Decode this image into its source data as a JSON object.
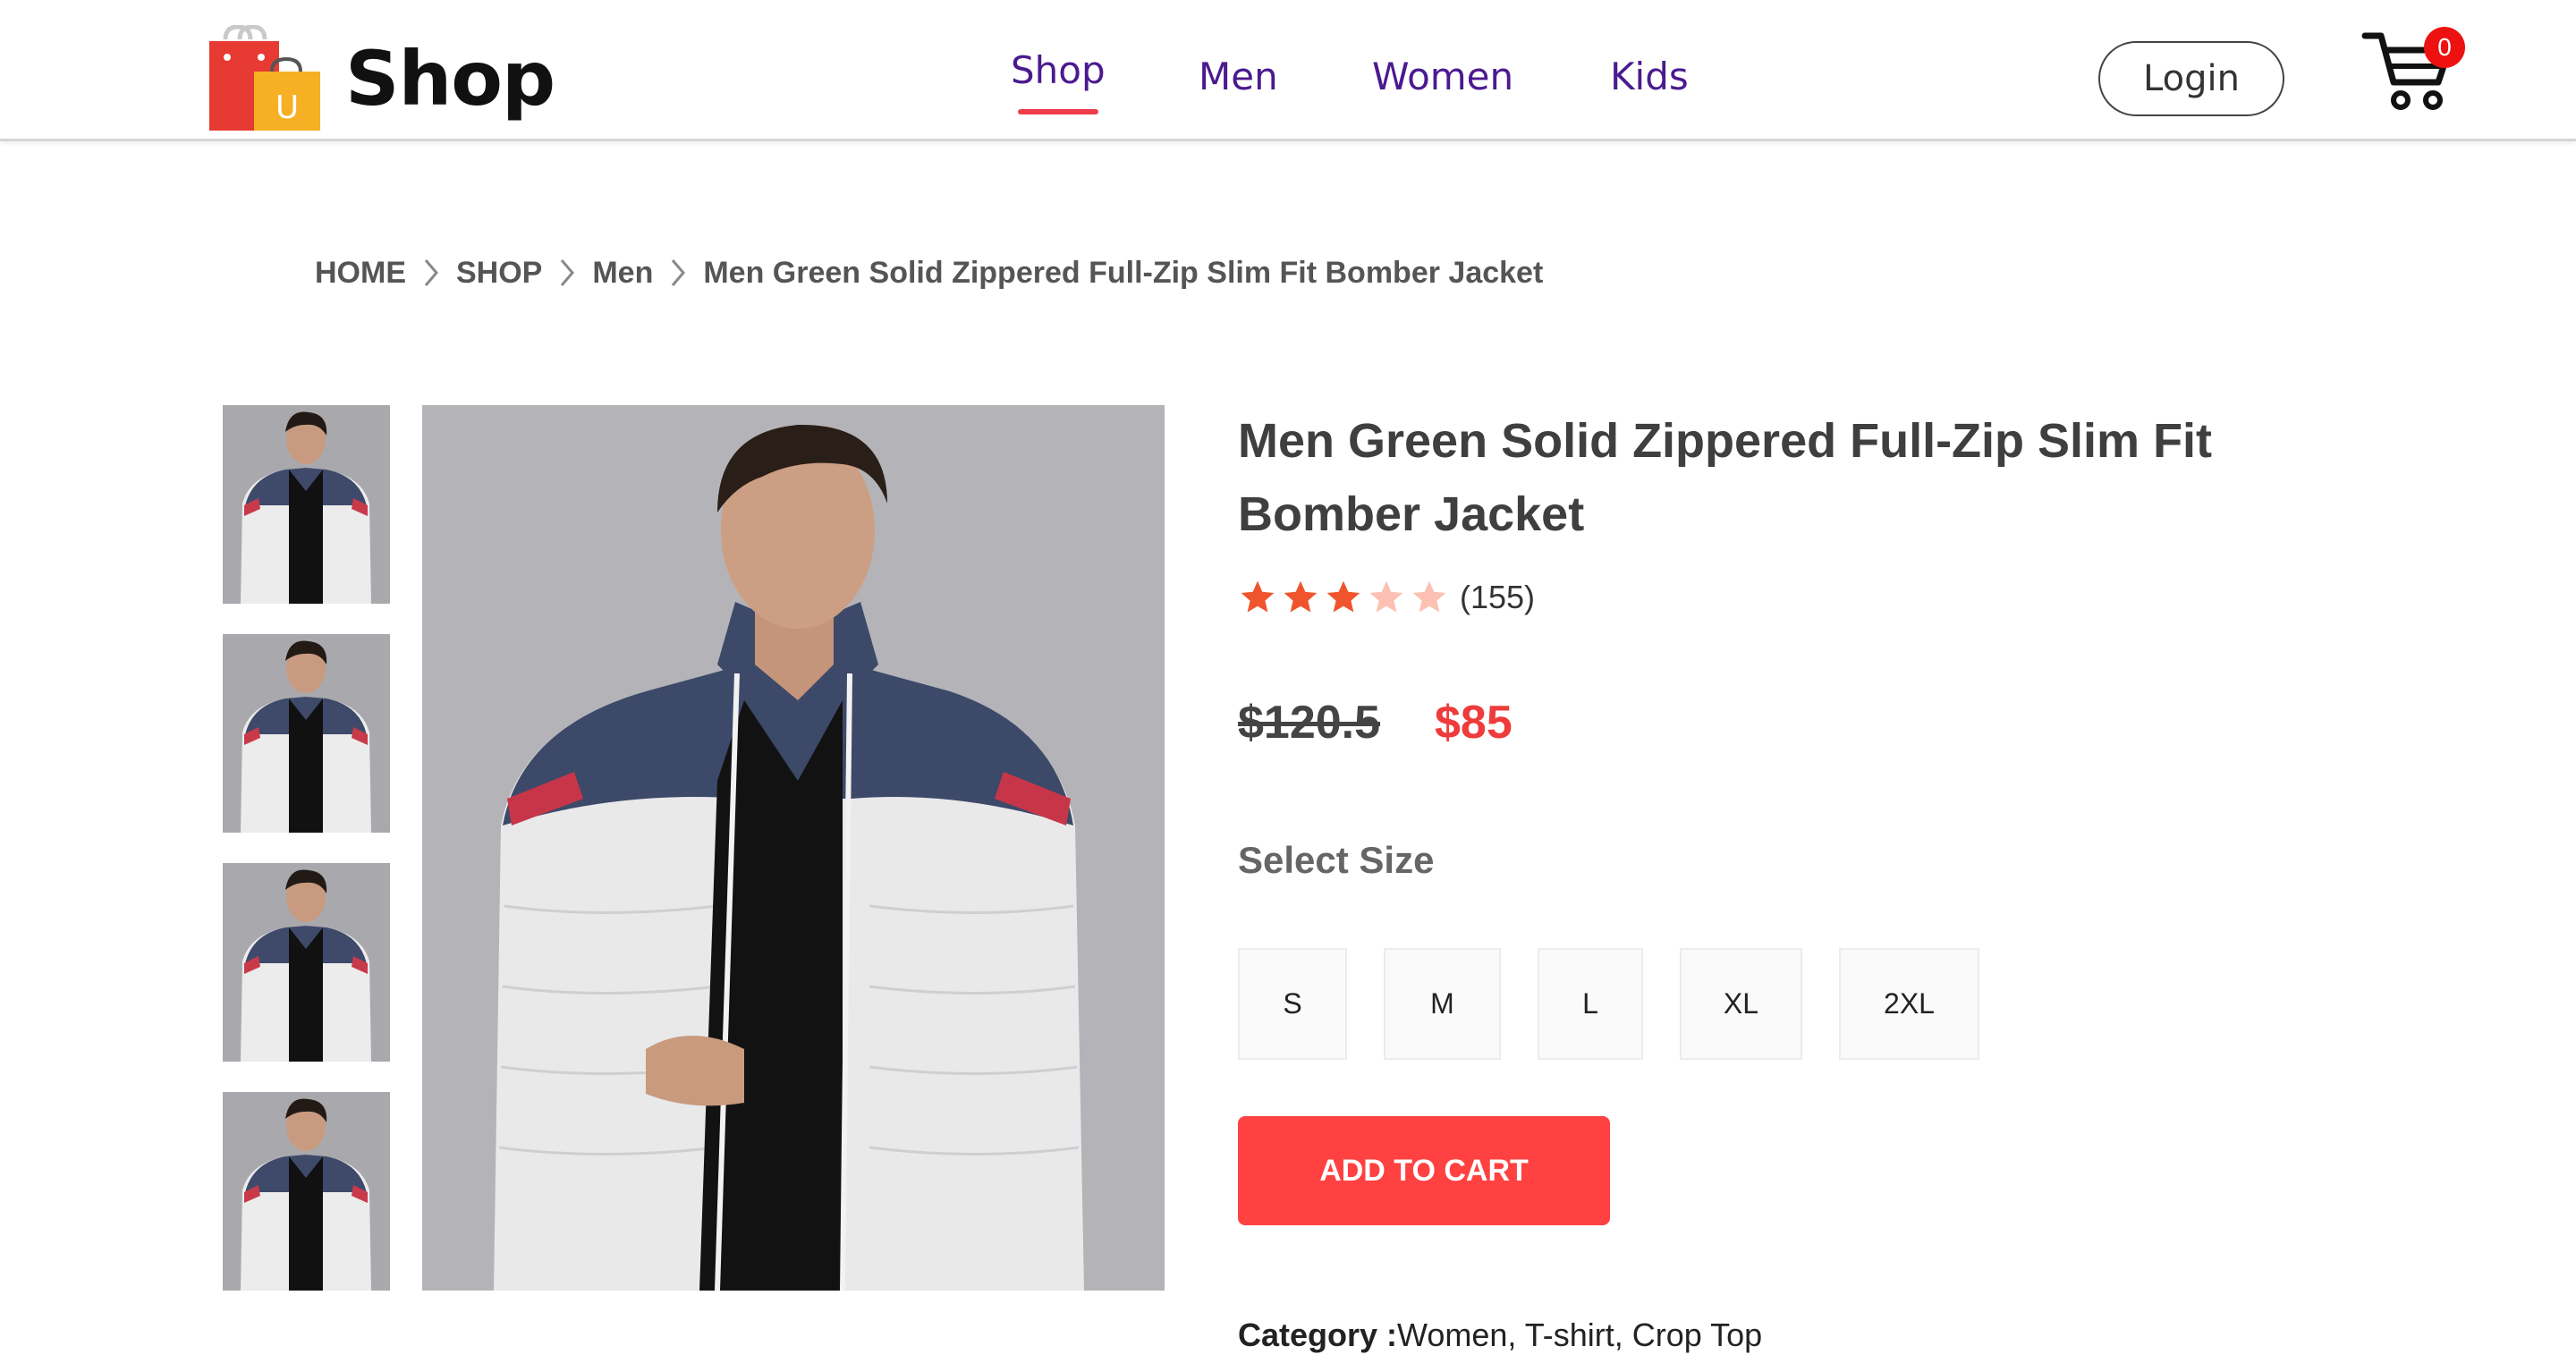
{
  "brand": {
    "name": "Shop",
    "logo_letter": "U"
  },
  "nav": {
    "items": [
      {
        "label": "Shop",
        "active": true
      },
      {
        "label": "Men",
        "active": false
      },
      {
        "label": "Women",
        "active": false
      },
      {
        "label": "Kids",
        "active": false
      }
    ],
    "login_label": "Login",
    "cart_count": "0"
  },
  "breadcrumb": {
    "items": [
      "HOME",
      "SHOP",
      "Men",
      "Men Green Solid Zippered Full-Zip Slim Fit Bomber Jacket"
    ]
  },
  "product": {
    "title_line1": "Men Green Solid Zippered Full-Zip Slim Fit",
    "title_line2": "Bomber Jacket",
    "rating": 3,
    "rating_max": 5,
    "review_count": "(155)",
    "price_old": "$120.5",
    "price_new": "$85",
    "select_size_label": "Select Size",
    "sizes": [
      "S",
      "M",
      "L",
      "XL",
      "2XL"
    ],
    "add_to_cart_label": "ADD TO CART",
    "category_label": "Category :",
    "category_value": "Women, T-shirt, Crop Top"
  },
  "colors": {
    "accent": "#ee3d4c",
    "nav_text": "#4b1a8f",
    "price_sale": "#ee3b3b",
    "add_to_cart_bg": "#ff4141",
    "star_filled": "#f0542d",
    "star_empty": "#fcc1b2"
  },
  "icons": {
    "logo": "shopping-bag-icon",
    "cart": "shopping-cart-icon",
    "breadcrumb_separator": "chevron-right-icon",
    "rating": "star-icon"
  }
}
